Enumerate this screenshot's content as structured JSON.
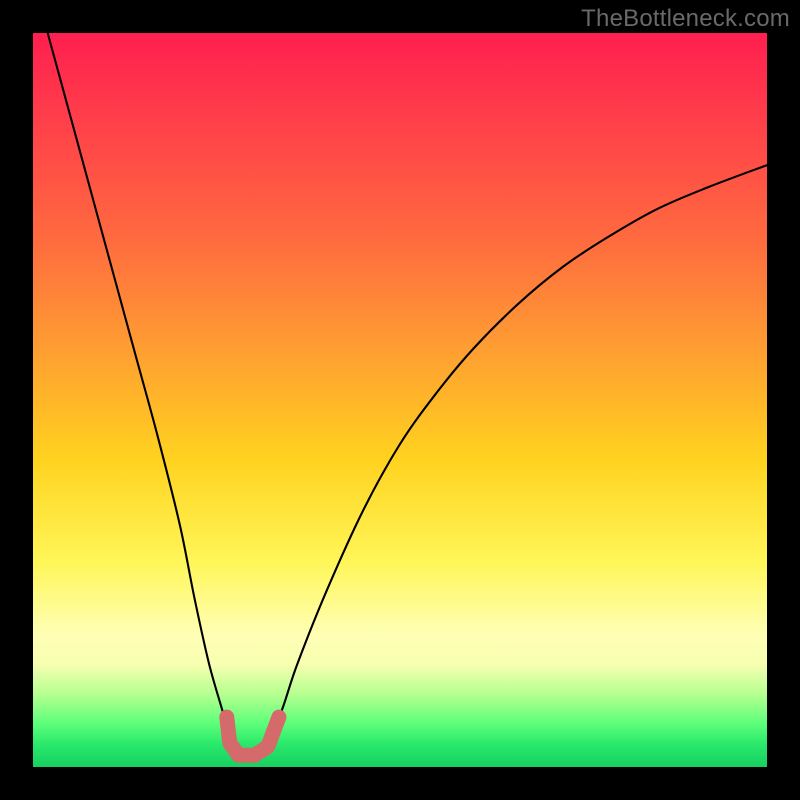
{
  "watermark": "TheBottleneck.com",
  "colors": {
    "frame": "#000000",
    "curve": "#000000",
    "markers": "#d46a6a",
    "gradient_top": "#ff1f4f",
    "gradient_bottom": "#17d060"
  },
  "chart_data": {
    "type": "line",
    "title": "",
    "xlabel": "",
    "ylabel": "",
    "xlim": [
      0,
      100
    ],
    "ylim": [
      0,
      100
    ],
    "grid": false,
    "note": "V-shaped bottleneck curve; values are percentage height read off the vertical gradient (0 = bottom/green, 100 = top/red). x is normalized horizontal position 0–100.",
    "series": [
      {
        "name": "bottleneck-curve",
        "x": [
          2,
          5,
          8,
          11,
          14,
          17,
          20,
          22,
          24,
          26,
          27,
          28.5,
          30,
          32,
          34,
          36,
          40,
          45,
          50,
          55,
          60,
          66,
          72,
          78,
          85,
          92,
          100
        ],
        "values": [
          100,
          89,
          78,
          67,
          56,
          45,
          33,
          23,
          14,
          7,
          3,
          1,
          1,
          3,
          8,
          14,
          24,
          35,
          44,
          51,
          57,
          63,
          68,
          72,
          76,
          79,
          82
        ]
      }
    ],
    "markers": {
      "name": "highlight-L",
      "note": "Short thick salmon L-shape at the curve minimum",
      "points_xy": [
        [
          26.4,
          6.8
        ],
        [
          26.8,
          3.3
        ],
        [
          28.0,
          1.6
        ],
        [
          30.2,
          1.6
        ],
        [
          32.0,
          2.8
        ],
        [
          33.5,
          6.8
        ]
      ]
    }
  }
}
